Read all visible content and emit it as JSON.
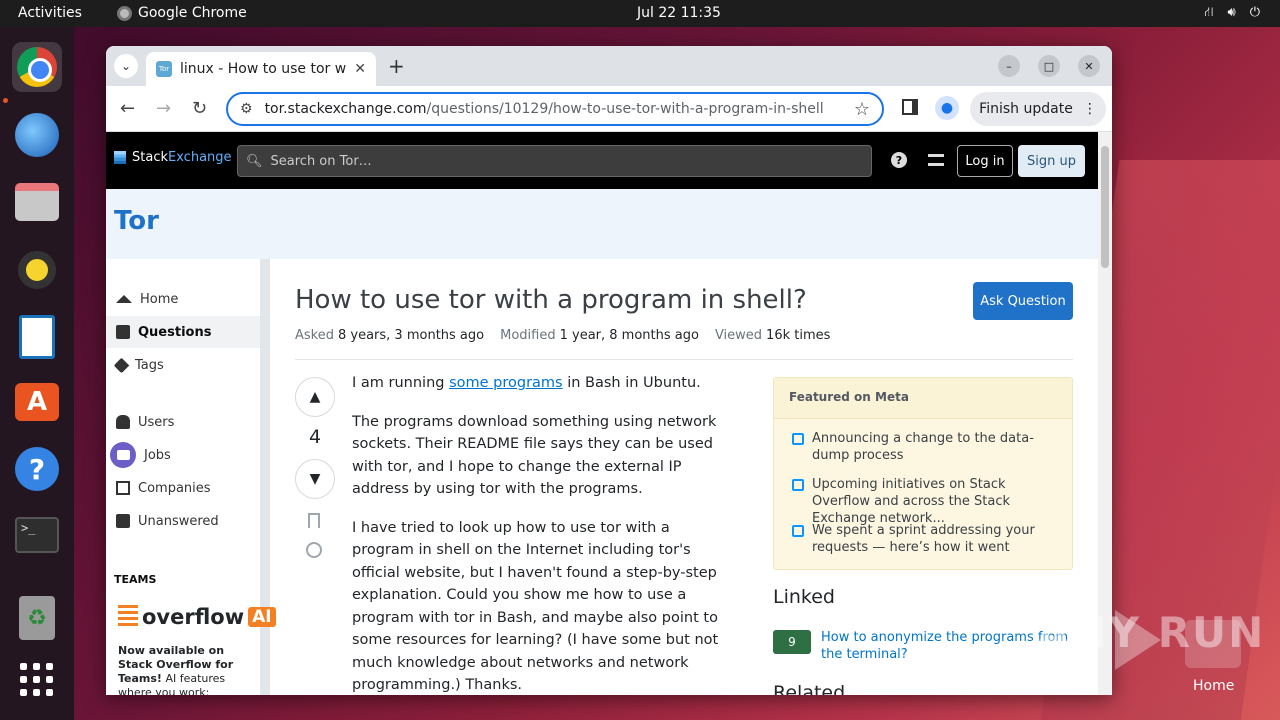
{
  "topbar": {
    "activities": "Activities",
    "app_name": "Google Chrome",
    "clock": "Jul 22  11:35",
    "tray_icons": [
      "network-icon",
      "volume-icon",
      "power-icon"
    ]
  },
  "dock": {
    "items": [
      "chrome-icon",
      "thunderbird-icon",
      "files-icon",
      "rhythmbox-icon",
      "writer-icon",
      "app-center-icon",
      "help-icon",
      "terminal-icon",
      "trash-icon",
      "app-grid-icon"
    ]
  },
  "browser": {
    "tab_title": "linux - How to use tor with a program in shell",
    "tab_favicon_text": "Tor",
    "new_tab": "+",
    "url_host": "tor.stackexchange.com",
    "url_path": "/questions/10129/how-to-use-tor-with-a-program-in-shell",
    "finish_update": "Finish update",
    "back": "←",
    "forward": "→",
    "reload": "↻",
    "bookmark_star": "☆",
    "more": "⋮",
    "minimize": "–",
    "maximize": "□",
    "close": "✕",
    "tab_close": "✕",
    "tab_list": "⌄"
  },
  "se": {
    "logo_a": "Stack",
    "logo_b": "Exchange",
    "search_placeholder": "Search on Tor…",
    "help": "?",
    "login": "Log in",
    "signup": "Sign up",
    "site_name": "Tor"
  },
  "leftnav": {
    "items": [
      {
        "label": "Home",
        "icon": "home-icon"
      },
      {
        "label": "Questions",
        "icon": "questions-icon"
      },
      {
        "label": "Tags",
        "icon": "tag-icon"
      },
      {
        "label": "Users",
        "icon": "users-icon"
      },
      {
        "label": "Jobs",
        "icon": "jobs-icon"
      },
      {
        "label": "Companies",
        "icon": "companies-icon"
      },
      {
        "label": "Unanswered",
        "icon": "unanswered-icon"
      }
    ],
    "teams_label": "TEAMS",
    "overflow_ai_word": "overflow",
    "overflow_ai_badge": "AI",
    "promo_bold": "Now available on Stack Overflow for Teams!",
    "promo_rest": " AI features where you work: search, IDE, and chat."
  },
  "question": {
    "title": "How to use tor with a program in shell?",
    "ask_button": "Ask Question",
    "asked_label": "Asked",
    "asked_value": "8 years, 3 months ago",
    "modified_label": "Modified",
    "modified_value": "1 year, 8 months ago",
    "viewed_label": "Viewed",
    "viewed_value": "16k times",
    "votes": "4",
    "p1_pre": "I am running ",
    "p1_link": "some programs",
    "p1_post": " in Bash in Ubuntu.",
    "p2": "The programs download something using network sockets. Their README file says they can be used with tor, and I hope to change the external IP address by using tor with the programs.",
    "p3": "I have tried to look up how to use tor with a program in shell on the Internet including tor's official website, but I haven't found a step-by-step explanation. Could you show me how to use a program with tor in Bash, and maybe also point to some resources for learning? (I have some but not much knowledge about networks and network programming.) Thanks."
  },
  "sidebar": {
    "featured_heading": "Featured on Meta",
    "featured_items": [
      "Announcing a change to the data-dump process",
      "Upcoming initiatives on Stack Overflow and across the Stack Exchange network...",
      "We spent a sprint addressing your requests — here’s how it went"
    ],
    "linked_heading": "Linked",
    "linked_count": "9",
    "linked_text": "How to anonymize the programs from the terminal?",
    "related_heading": "Related"
  },
  "watermark": {
    "text": "ANY  RUN",
    "home_label": "Home"
  }
}
